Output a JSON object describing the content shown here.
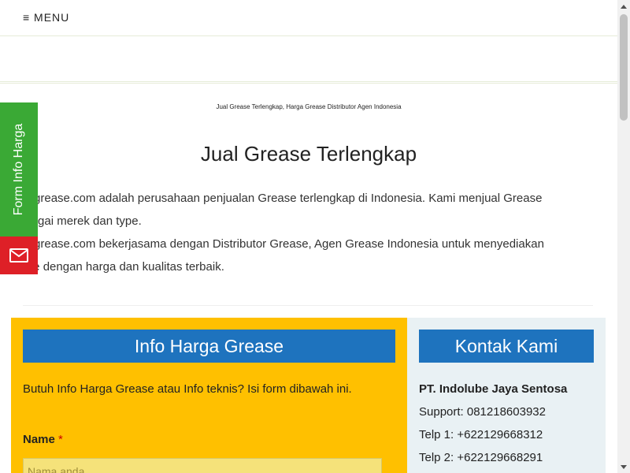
{
  "topbar": {
    "menu_label": "≡ MENU"
  },
  "breadcrumb": "Jual Grease Terlengkap, Harga Grease Distributor Agen Indonesia",
  "page_title": "Jual Grease Terlengkap",
  "paragraphs": [
    {
      "line1": "ndogrease.com adalah perusahaan penjualan Grease terlengkap di Indonesia. Kami menjual Grease",
      "line2": "erbagai merek dan type."
    },
    {
      "line1": "ndogrease.com bekerjasama dengan Distributor Grease, Agen Grease Indonesia untuk menyediakan",
      "line2": "ease dengan harga dan kualitas terbaik."
    }
  ],
  "form": {
    "heading": "Info Harga Grease",
    "description": "Butuh Info Harga Grease atau Info teknis? Isi form dibawah ini.",
    "name_label": "Name",
    "required_mark": "*",
    "name_placeholder": "Nama anda",
    "name_value": ""
  },
  "contact": {
    "heading": "Kontak Kami",
    "lines": [
      "PT. Indolube Jaya Sentosa",
      "Support: 081218603932",
      "Telp 1: +622129668312",
      "Telp 2: +622129668291"
    ]
  },
  "side_tab": {
    "label": "Form Info Harga",
    "color": "#3aa935",
    "mail_color": "#de2027",
    "mail_icon": "envelope-icon"
  },
  "colors": {
    "form_panel": "#ffc000",
    "heading_blue": "#1e73be",
    "contact_panel": "#e9f1f4"
  }
}
